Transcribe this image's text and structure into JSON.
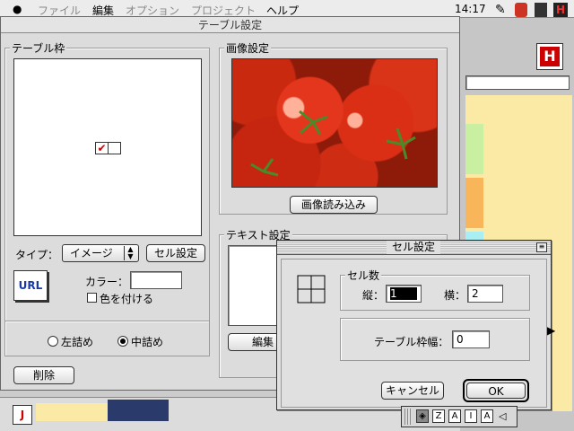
{
  "menubar": {
    "apple": "",
    "file": "ファイル",
    "edit": "編集",
    "option": "オプション",
    "project": "プロジェクト",
    "help": "ヘルプ",
    "clock": "14:17"
  },
  "window": {
    "title": "テーブル設定",
    "table_frame": {
      "label": "テーブル枠",
      "type_label": "タイプ：",
      "type_value": "イメージ",
      "cell_settings_button": "セル設定",
      "url_logo": "URL",
      "color_label": "カラー：",
      "color_checkbox": "色を付ける"
    },
    "alignment": {
      "left": "左詰め",
      "center": "中詰め",
      "selected": "center"
    },
    "delete_button": "削除",
    "image_settings": {
      "label": "画像設定",
      "load_button": "画像読み込み"
    },
    "text_settings": {
      "label": "テキスト設定",
      "edit_button": "編集"
    }
  },
  "cell_dialog": {
    "title": "セル設定",
    "cell_count_label": "セル数",
    "vertical_label": "縦：",
    "vertical_value": "1",
    "horizontal_label": "横：",
    "horizontal_value": "2",
    "border_width_label": "テーブル枠幅：",
    "border_width_value": "0",
    "cancel_button": "キャンセル",
    "ok_button": "OK"
  },
  "colors": {
    "accent": "#cc0000",
    "swatch_yellow": "#fbe9a6",
    "swatch_green": "#c8f0a0",
    "swatch_orange": "#f9b55a",
    "swatch_cyan": "#a8eef2"
  }
}
